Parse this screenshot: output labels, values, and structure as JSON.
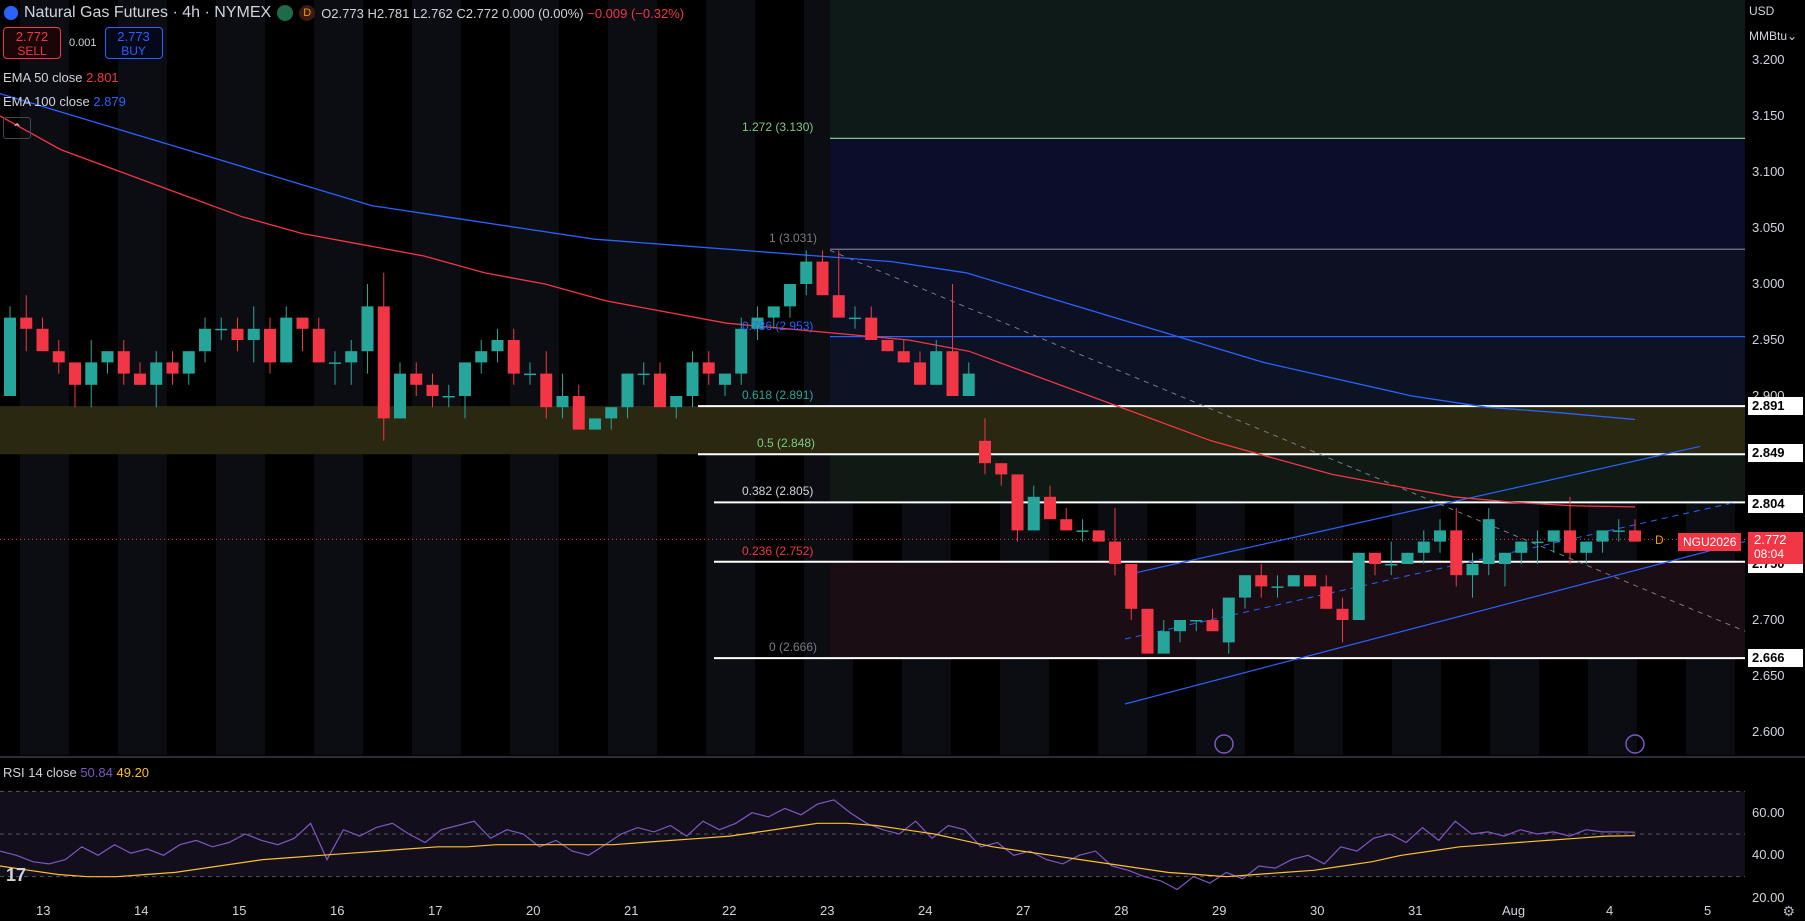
{
  "header": {
    "title": "Natural Gas Futures · 4h · NYMEX",
    "dot_label": "D",
    "ohlc": {
      "o": "O2.773",
      "h": "H2.781",
      "l": "L2.762",
      "c": "C2.772",
      "chg": "0.000 (0.00%)",
      "chg2": "−0.009 (−0.32%)"
    }
  },
  "trade": {
    "sell_price": "2.772",
    "sell_label": "SELL",
    "spread": "0.001",
    "buy_price": "2.773",
    "buy_label": "BUY"
  },
  "indicators": {
    "ema50_label": "EMA 50 close",
    "ema50_value": "2.801",
    "ema100_label": "EMA 100 close",
    "ema100_value": "2.879",
    "collapse_icon": "chevron-up-icon"
  },
  "price_scale": {
    "currency": "USD",
    "unit": "MMBtu",
    "ticks": [
      "3.200",
      "3.150",
      "3.100",
      "3.050",
      "3.000",
      "2.950",
      "2.900",
      "2.850",
      "2.800",
      "2.750",
      "2.700",
      "2.650",
      "2.600"
    ],
    "tags": [
      "2.891",
      "2.849",
      "2.804",
      "2.750",
      "2.666"
    ],
    "current_price": "2.772",
    "countdown": "08:04",
    "symbol_tag": "NGU2026",
    "d_marker": "D"
  },
  "fib_levels": [
    {
      "label": "1.272 (3.130)",
      "price": 3.13,
      "color": "#81c784"
    },
    {
      "label": "1 (3.031)",
      "price": 3.031,
      "color": "#787b86"
    },
    {
      "label": "0.786 (2.953)",
      "price": 2.953,
      "color": "#2962ff"
    },
    {
      "label": "0.618 (2.891)",
      "price": 2.891,
      "color": "#26a69a"
    },
    {
      "label": "0.5 (2.848)",
      "price": 2.848,
      "color": "#81c784"
    },
    {
      "label": "0.382 (2.805)",
      "price": 2.805,
      "color": "#d1d4dc"
    },
    {
      "label": "0.236 (2.752)",
      "price": 2.752,
      "color": "#f23645"
    },
    {
      "label": "0 (2.666)",
      "price": 2.666,
      "color": "#787b86"
    }
  ],
  "time_axis": [
    "13",
    "14",
    "15",
    "16",
    "17",
    "20",
    "21",
    "22",
    "23",
    "24",
    "27",
    "28",
    "29",
    "30",
    "31",
    "Aug",
    "4",
    "5"
  ],
  "rsi": {
    "label": "RSI 14 close",
    "value": "50.84",
    "ma_value": "49.20",
    "ticks": [
      "60.00",
      "40.00",
      "20.00"
    ]
  },
  "colors": {
    "up": "#26a69a",
    "down": "#f23645",
    "ema50": "#f23645",
    "ema100": "#2962ff",
    "rsi": "#7e57c2",
    "rsi_ma": "#fbc02d"
  },
  "chart_data": {
    "type": "candlestick",
    "ylim": [
      2.58,
      3.23
    ],
    "candles": [
      [
        2.9,
        2.98,
        2.9,
        2.97
      ],
      [
        2.97,
        2.99,
        2.94,
        2.96
      ],
      [
        2.96,
        2.97,
        2.94,
        2.94
      ],
      [
        2.94,
        2.95,
        2.92,
        2.93
      ],
      [
        2.93,
        2.93,
        2.89,
        2.91
      ],
      [
        2.91,
        2.95,
        2.89,
        2.93
      ],
      [
        2.93,
        2.94,
        2.92,
        2.94
      ],
      [
        2.94,
        2.95,
        2.91,
        2.92
      ],
      [
        2.92,
        2.93,
        2.91,
        2.91
      ],
      [
        2.91,
        2.94,
        2.89,
        2.93
      ],
      [
        2.93,
        2.94,
        2.91,
        2.92
      ],
      [
        2.92,
        2.94,
        2.91,
        2.94
      ],
      [
        2.94,
        2.97,
        2.93,
        2.96
      ],
      [
        2.96,
        2.97,
        2.95,
        2.96
      ],
      [
        2.96,
        2.97,
        2.94,
        2.95
      ],
      [
        2.95,
        2.98,
        2.93,
        2.96
      ],
      [
        2.96,
        2.97,
        2.92,
        2.93
      ],
      [
        2.93,
        2.98,
        2.93,
        2.97
      ],
      [
        2.97,
        2.97,
        2.94,
        2.96
      ],
      [
        2.96,
        2.97,
        2.93,
        2.93
      ],
      [
        2.93,
        2.94,
        2.91,
        2.93
      ],
      [
        2.93,
        2.95,
        2.91,
        2.94
      ],
      [
        2.94,
        3.0,
        2.92,
        2.98
      ],
      [
        2.98,
        3.01,
        2.86,
        2.88
      ],
      [
        2.88,
        2.93,
        2.88,
        2.92
      ],
      [
        2.92,
        2.93,
        2.9,
        2.91
      ],
      [
        2.91,
        2.92,
        2.89,
        2.9
      ],
      [
        2.9,
        2.91,
        2.89,
        2.9
      ],
      [
        2.9,
        2.93,
        2.88,
        2.93
      ],
      [
        2.93,
        2.95,
        2.92,
        2.94
      ],
      [
        2.94,
        2.96,
        2.93,
        2.95
      ],
      [
        2.95,
        2.96,
        2.91,
        2.92
      ],
      [
        2.92,
        2.93,
        2.91,
        2.92
      ],
      [
        2.92,
        2.94,
        2.88,
        2.89
      ],
      [
        2.89,
        2.92,
        2.88,
        2.9
      ],
      [
        2.9,
        2.91,
        2.87,
        2.87
      ],
      [
        2.87,
        2.88,
        2.87,
        2.88
      ],
      [
        2.88,
        2.89,
        2.87,
        2.89
      ],
      [
        2.89,
        2.92,
        2.88,
        2.92
      ],
      [
        2.92,
        2.93,
        2.91,
        2.92
      ],
      [
        2.92,
        2.93,
        2.89,
        2.89
      ],
      [
        2.89,
        2.9,
        2.88,
        2.9
      ],
      [
        2.9,
        2.94,
        2.89,
        2.93
      ],
      [
        2.93,
        2.94,
        2.91,
        2.92
      ],
      [
        2.91,
        2.92,
        2.9,
        2.92
      ],
      [
        2.92,
        2.97,
        2.91,
        2.96
      ],
      [
        2.96,
        2.98,
        2.95,
        2.97
      ],
      [
        2.97,
        2.98,
        2.96,
        2.98
      ],
      [
        2.98,
        3.0,
        2.97,
        3.0
      ],
      [
        3.0,
        3.03,
        2.99,
        3.02
      ],
      [
        3.02,
        3.03,
        2.99,
        2.99
      ],
      [
        2.99,
        3.03,
        2.97,
        2.97
      ],
      [
        2.97,
        2.98,
        2.96,
        2.97
      ],
      [
        2.97,
        2.98,
        2.95,
        2.95
      ],
      [
        2.95,
        2.95,
        2.94,
        2.94
      ],
      [
        2.94,
        2.95,
        2.93,
        2.93
      ],
      [
        2.93,
        2.94,
        2.91,
        2.91
      ],
      [
        2.91,
        2.95,
        2.91,
        2.94
      ],
      [
        2.94,
        3.0,
        2.9,
        2.9
      ],
      [
        2.9,
        2.93,
        2.9,
        2.92
      ],
      [
        2.86,
        2.88,
        2.83,
        2.84
      ],
      [
        2.84,
        2.84,
        2.82,
        2.83
      ],
      [
        2.83,
        2.83,
        2.77,
        2.78
      ],
      [
        2.78,
        2.82,
        2.79,
        2.81
      ],
      [
        2.81,
        2.82,
        2.79,
        2.79
      ],
      [
        2.79,
        2.8,
        2.78,
        2.78
      ],
      [
        2.78,
        2.79,
        2.77,
        2.78
      ],
      [
        2.78,
        2.78,
        2.77,
        2.77
      ],
      [
        2.77,
        2.8,
        2.74,
        2.75
      ],
      [
        2.75,
        2.75,
        2.7,
        2.71
      ],
      [
        2.71,
        2.71,
        2.67,
        2.67
      ],
      [
        2.67,
        2.7,
        2.67,
        2.69
      ],
      [
        2.69,
        2.7,
        2.68,
        2.7
      ],
      [
        2.7,
        2.7,
        2.69,
        2.7
      ],
      [
        2.7,
        2.71,
        2.69,
        2.69
      ],
      [
        2.68,
        2.72,
        2.67,
        2.72
      ],
      [
        2.72,
        2.74,
        2.71,
        2.74
      ],
      [
        2.74,
        2.75,
        2.72,
        2.73
      ],
      [
        2.73,
        2.74,
        2.72,
        2.73
      ],
      [
        2.73,
        2.74,
        2.73,
        2.74
      ],
      [
        2.74,
        2.74,
        2.73,
        2.73
      ],
      [
        2.73,
        2.74,
        2.71,
        2.71
      ],
      [
        2.71,
        2.72,
        2.68,
        2.7
      ],
      [
        2.7,
        2.76,
        2.7,
        2.76
      ],
      [
        2.76,
        2.76,
        2.74,
        2.75
      ],
      [
        2.75,
        2.77,
        2.74,
        2.75
      ],
      [
        2.75,
        2.76,
        2.75,
        2.76
      ],
      [
        2.76,
        2.78,
        2.75,
        2.77
      ],
      [
        2.77,
        2.79,
        2.76,
        2.78
      ],
      [
        2.78,
        2.8,
        2.73,
        2.74
      ],
      [
        2.74,
        2.76,
        2.72,
        2.75
      ],
      [
        2.75,
        2.8,
        2.74,
        2.79
      ],
      [
        2.75,
        2.76,
        2.73,
        2.76
      ],
      [
        2.76,
        2.77,
        2.75,
        2.77
      ],
      [
        2.77,
        2.78,
        2.75,
        2.77
      ],
      [
        2.77,
        2.78,
        2.76,
        2.78
      ],
      [
        2.78,
        2.81,
        2.75,
        2.76
      ],
      [
        2.76,
        2.77,
        2.75,
        2.77
      ],
      [
        2.77,
        2.78,
        2.76,
        2.78
      ],
      [
        2.78,
        2.79,
        2.77,
        2.78
      ],
      [
        2.78,
        2.79,
        2.77,
        2.77
      ]
    ],
    "ema50": [
      3.15,
      3.12,
      3.1,
      3.08,
      3.06,
      3.045,
      3.035,
      3.025,
      3.01,
      3.0,
      2.985,
      2.975,
      2.965,
      2.96,
      2.955,
      2.95,
      2.94,
      2.92,
      2.9,
      2.88,
      2.86,
      2.845,
      2.83,
      2.82,
      2.81,
      2.805,
      2.802,
      2.801
    ],
    "ema100": [
      3.17,
      3.15,
      3.13,
      3.11,
      3.09,
      3.07,
      3.06,
      3.05,
      3.04,
      3.035,
      3.03,
      3.025,
      3.02,
      3.01,
      2.99,
      2.97,
      2.95,
      2.93,
      2.915,
      2.9,
      2.89,
      2.885,
      2.879
    ],
    "rsi": [
      42,
      40,
      37,
      36,
      38,
      44,
      40,
      45,
      41,
      43,
      40,
      45,
      47,
      44,
      46,
      50,
      47,
      45,
      48,
      55,
      38,
      52,
      49,
      53,
      55,
      50,
      46,
      52,
      54,
      56,
      48,
      52,
      50,
      44,
      47,
      42,
      40,
      45,
      50,
      53,
      51,
      54,
      49,
      56,
      52,
      55,
      60,
      58,
      62,
      59,
      64,
      66,
      60,
      55,
      52,
      50,
      56,
      48,
      54,
      52,
      44,
      46,
      40,
      42,
      38,
      36,
      40,
      42,
      35,
      33,
      30,
      28,
      24,
      30,
      27,
      32,
      29,
      35,
      34,
      38,
      40,
      36,
      44,
      42,
      48,
      50,
      46,
      53,
      47,
      56,
      50,
      51,
      49,
      52,
      50,
      51,
      49,
      52,
      51,
      51,
      50.84
    ],
    "rsi_ma": [
      35,
      33,
      31,
      30,
      30,
      31,
      32,
      34,
      36,
      38,
      39,
      40,
      41,
      42,
      43,
      44,
      44,
      45,
      45,
      45,
      45,
      45,
      46,
      47,
      48,
      49,
      51,
      53,
      55,
      55,
      54,
      52,
      50,
      47,
      44,
      42,
      40,
      38,
      36,
      34,
      32,
      31,
      30,
      31,
      32,
      33,
      35,
      37,
      40,
      42,
      44,
      45,
      46,
      47,
      48,
      49,
      49.2
    ]
  }
}
